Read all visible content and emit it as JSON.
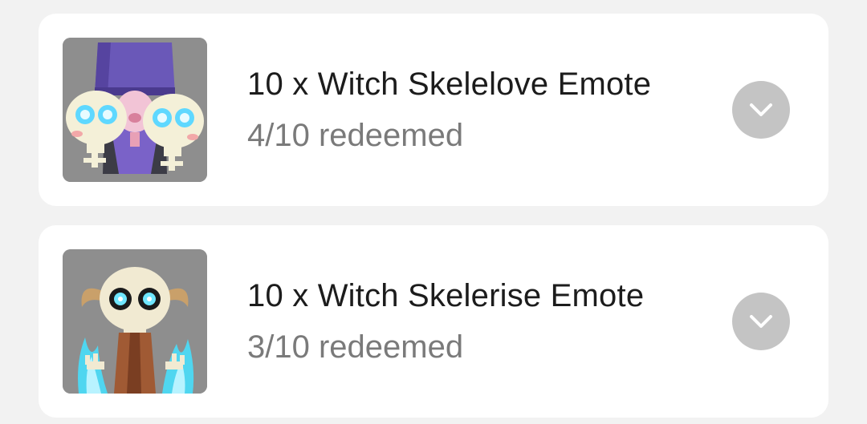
{
  "rewards": [
    {
      "title": "10 x Witch Skelelove Emote",
      "status": "4/10 redeemed",
      "thumbnail_icon": "witch-skelelove-emote-icon",
      "expand_icon": "chevron-down-icon"
    },
    {
      "title": "10 x Witch Skelerise Emote",
      "status": "3/10 redeemed",
      "thumbnail_icon": "witch-skelerise-emote-icon",
      "expand_icon": "chevron-down-icon"
    }
  ],
  "colors": {
    "page_background": "#f2f2f2",
    "card_background": "#ffffff",
    "title_text": "#1c1c1c",
    "status_text": "#7a7a7a",
    "expand_button": "#c4c4c4",
    "expand_chevron": "#ffffff"
  }
}
